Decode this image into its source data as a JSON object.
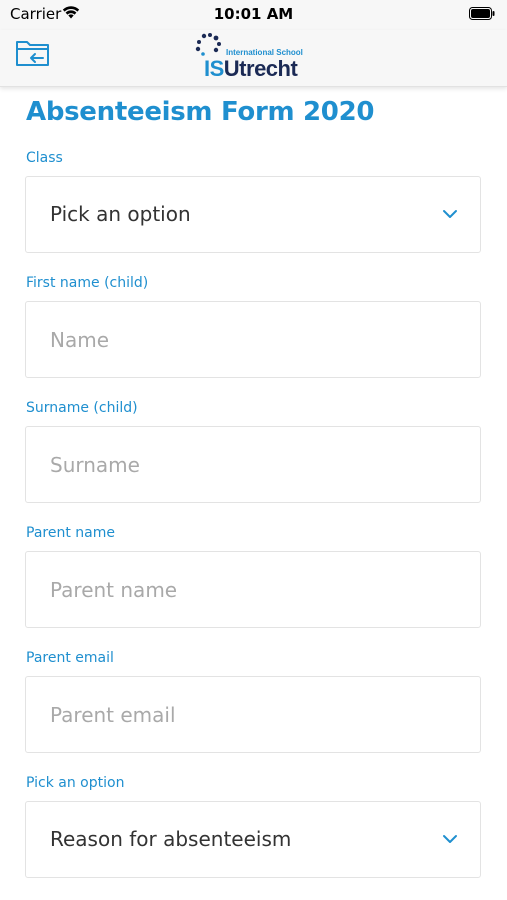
{
  "status_bar": {
    "carrier": "Carrier",
    "time": "10:01 AM"
  },
  "nav": {
    "back_icon": "folder-back-icon",
    "logo": {
      "small_text": "International School",
      "is_text": "IS",
      "name_text": "Utrecht"
    }
  },
  "form": {
    "title": "Absenteeism Form 2020",
    "fields": [
      {
        "label": "Class",
        "type": "select",
        "value": "Pick an option"
      },
      {
        "label": "First name (child)",
        "type": "text",
        "placeholder": "Name"
      },
      {
        "label": "Surname (child)",
        "type": "text",
        "placeholder": "Surname"
      },
      {
        "label": "Parent name",
        "type": "text",
        "placeholder": "Parent name"
      },
      {
        "label": "Parent email",
        "type": "text",
        "placeholder": "Parent email"
      },
      {
        "label": "Pick an option",
        "type": "select",
        "value": "Reason for absenteeism"
      }
    ]
  },
  "colors": {
    "accent": "#1f8fcf",
    "logo_dark": "#1b2a55",
    "border": "#e3e3e3",
    "placeholder": "#a9a9a9"
  }
}
